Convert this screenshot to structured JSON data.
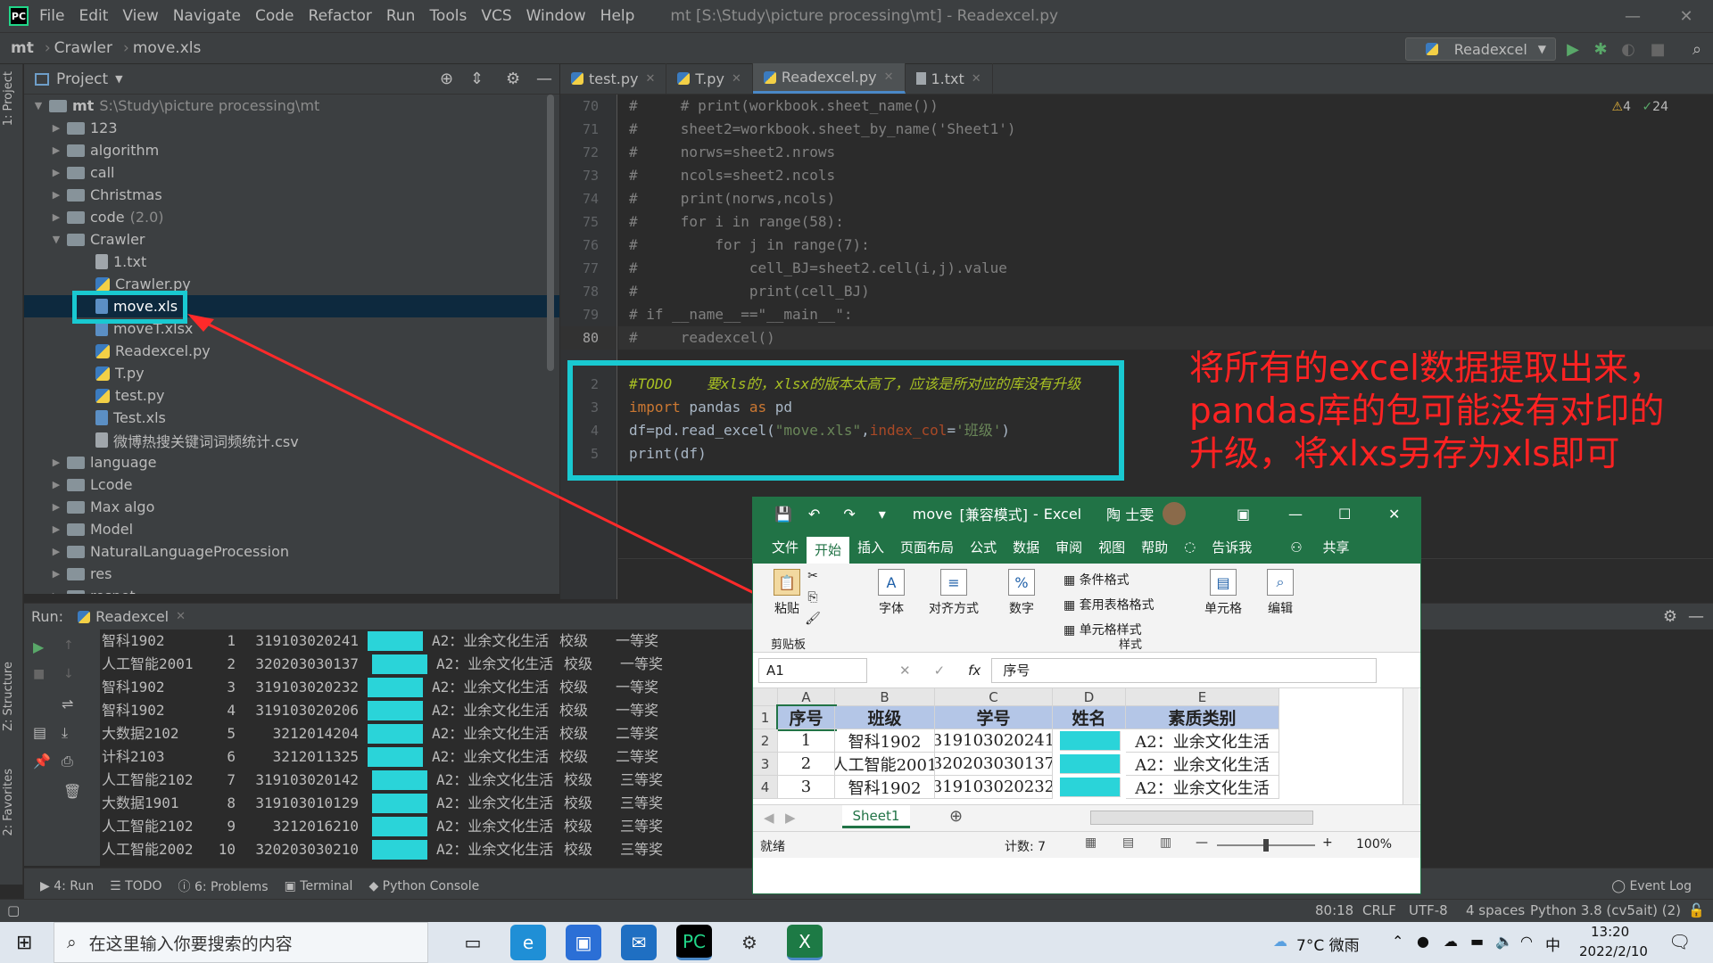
{
  "menubar": {
    "items": [
      "File",
      "Edit",
      "View",
      "Navigate",
      "Code",
      "Refactor",
      "Run",
      "Tools",
      "VCS",
      "Window",
      "Help"
    ],
    "title": "mt [S:\\Study\\picture processing\\mt] - Readexcel.py"
  },
  "navbar": {
    "crumb1": "mt",
    "crumb2": "Crawler",
    "crumb3": "move.xls",
    "run_config": "Readexcel"
  },
  "project": {
    "header": "Project",
    "strip_label": "1: Project",
    "root": {
      "name": "mt",
      "path": "S:\\Study\\picture processing\\mt"
    },
    "folders_top": [
      "123",
      "algorithm",
      "call",
      "Christmas"
    ],
    "code_folder": {
      "name": "code",
      "hint": "(2.0)"
    },
    "crawler": "Crawler",
    "crawler_files": [
      "1.txt",
      "Crawler.py",
      "move.xls",
      "moveT.xlsx",
      "Readexcel.py",
      "T.py",
      "test.py",
      "Test.xls",
      "微博热搜关键词词频统计.csv"
    ],
    "folders_bottom": [
      "language",
      "Lcode",
      "Max algo",
      "Model",
      "NaturalLanguageProcession",
      "res",
      "resnet"
    ]
  },
  "editor": {
    "tabs": [
      "test.py",
      "T.py",
      "Readexcel.py",
      "1.txt"
    ],
    "warnings": "4",
    "checks": "24",
    "line_numbers": [
      "70",
      "71",
      "72",
      "73",
      "74",
      "75",
      "76",
      "77",
      "78",
      "79",
      "80",
      "",
      "2",
      "3",
      "4",
      "5"
    ],
    "lines": [
      "#     # print(workbook.sheet_name())",
      "#     sheet2=workbook.sheet_by_name('Sheet1')",
      "#     norws=sheet2.nrows",
      "#     ncols=sheet2.ncols",
      "#     print(norws,ncols)",
      "#     for i in range(58):",
      "#         for j in range(7):",
      "#             cell_BJ=sheet2.cell(i,j).value",
      "#             print(cell_BJ)",
      "# if __name__==\"__main__\":",
      "#     readexcel()"
    ],
    "todo_line": "#TODO    要xls的，xlsx的版本太高了，应该是所对应的库没有升级",
    "import_kw1": "import",
    "import_mod": " pandas ",
    "import_kw2": "as",
    "import_alias": " pd",
    "read_pre": "df=pd.read_excel(",
    "read_str1": "\"move.xls\"",
    "read_mid": ",",
    "read_param": "index_col",
    "read_eq": "=",
    "read_str2": "'班级'",
    "read_post": ")",
    "print_line": "print(df)"
  },
  "annotation": {
    "text": "将所有的excel数据提取出来，pandas库的包可能没有对印的升级，将xlxs另存为xls即可"
  },
  "run": {
    "label": "Run:",
    "tab": "Readexcel",
    "rows": [
      [
        "智科1902",
        "1",
        "319103020241",
        "A2：业余文化生活",
        "校级",
        "一等奖"
      ],
      [
        "人工智能2001",
        "2",
        "320203030137",
        "A2：业余文化生活",
        "校级",
        "一等奖"
      ],
      [
        "智科1902",
        "3",
        "319103020232",
        "A2：业余文化生活",
        "校级",
        "一等奖"
      ],
      [
        "智科1902",
        "4",
        "319103020206",
        "A2：业余文化生活",
        "校级",
        "一等奖"
      ],
      [
        "大数据2102",
        "5",
        "3212014204",
        "A2：业余文化生活",
        "校级",
        "二等奖"
      ],
      [
        "计科2103",
        "6",
        "3212011325",
        "A2：业余文化生活",
        "校级",
        "二等奖"
      ],
      [
        "人工智能2102",
        "7",
        "319103020142",
        "A2：业余文化生活",
        "校级",
        "三等奖"
      ],
      [
        "大数据1901",
        "8",
        "319103010129",
        "A2：业余文化生活",
        "校级",
        "三等奖"
      ],
      [
        "人工智能2102",
        "9",
        "3212016210",
        "A2：业余文化生活",
        "校级",
        "三等奖"
      ],
      [
        "人工智能2002",
        "10",
        "320203030210",
        "A2：业余文化生活",
        "校级",
        "三等奖"
      ]
    ]
  },
  "side_labels": {
    "structure": "Z: Structure",
    "favorites": "2: Favorites"
  },
  "bottom_tabs": [
    "4: Run",
    "TODO",
    "6: Problems",
    "Terminal",
    "Python Console"
  ],
  "status": {
    "event_log": "Event Log",
    "position": "80:18",
    "crlf": "CRLF",
    "encoding": "UTF-8",
    "indent": "4 spaces",
    "interpreter": "Python 3.8 (cv5ait) (2)"
  },
  "excel": {
    "filename": "move",
    "mode": "[兼容模式]",
    "app": "Excel",
    "user": "陶 士雯",
    "tabs": [
      "文件",
      "开始",
      "插入",
      "页面布局",
      "公式",
      "数据",
      "审阅",
      "视图",
      "帮助",
      "告诉我",
      "共享"
    ],
    "ribbon": {
      "paste": "粘贴",
      "clipboard": "剪贴板",
      "font": "字体",
      "align": "对齐方式",
      "number": "数字",
      "cond": "条件格式",
      "table": "套用表格格式",
      "cellstyle": "单元格样式",
      "style": "样式",
      "cells": "单元格",
      "edit": "编辑"
    },
    "namebox": "A1",
    "formula": "序号",
    "col_letters": [
      "A",
      "B",
      "C",
      "D",
      "E"
    ],
    "row_numbers": [
      "1",
      "2",
      "3",
      "4"
    ],
    "headers": [
      "序号",
      "班级",
      "学号",
      "姓名",
      "素质类别"
    ],
    "rows": [
      [
        "1",
        "智科1902",
        "319103020241",
        "",
        "A2：业余文化生活"
      ],
      [
        "2",
        "人工智能2001",
        "320203030137",
        "",
        "A2：业余文化生活"
      ],
      [
        "3",
        "智科1902",
        "319103020232",
        "",
        "A2：业余文化生活"
      ]
    ],
    "sheet": "Sheet1",
    "status_ready": "就绪",
    "count": "计数: 7",
    "zoom": "100%"
  },
  "taskbar": {
    "search_placeholder": "在这里输入你要搜索的内容",
    "weather": "7°C 微雨",
    "ime": "中",
    "time": "13:20",
    "date": "2022/2/10"
  }
}
